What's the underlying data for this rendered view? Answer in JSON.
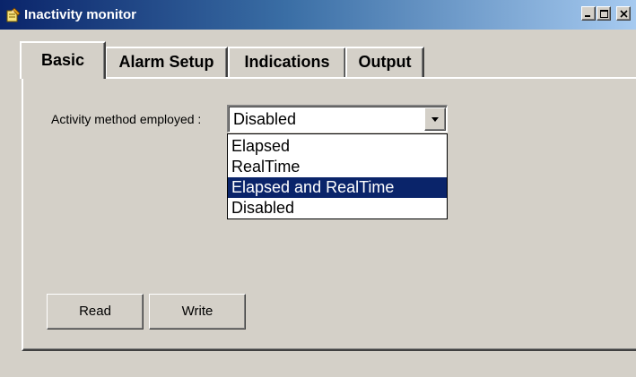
{
  "window": {
    "title": "Inactivity monitor",
    "app_icon": "note-pencil-icon",
    "controls": [
      "minimize-icon",
      "maximize-icon",
      "close-icon"
    ]
  },
  "tabs": [
    {
      "label": "Basic",
      "active": true
    },
    {
      "label": "Alarm Setup",
      "active": false
    },
    {
      "label": "Indications",
      "active": false
    },
    {
      "label": "Output",
      "active": false
    }
  ],
  "basic": {
    "activity_method": {
      "label": "Activity method employed :",
      "value": "Disabled",
      "expanded": true,
      "options": [
        {
          "label": "Elapsed",
          "highlighted": false
        },
        {
          "label": "RealTime",
          "highlighted": false
        },
        {
          "label": "Elapsed and RealTime",
          "highlighted": true
        },
        {
          "label": "Disabled",
          "highlighted": false
        }
      ]
    },
    "buttons": {
      "read_label": "Read",
      "write_label": "Write"
    }
  },
  "colors": {
    "face": "#d4d0c8",
    "title_start": "#0a246a",
    "title_end": "#a6caf0",
    "highlight": "#0a246a",
    "highlight_text": "#ffffff"
  }
}
